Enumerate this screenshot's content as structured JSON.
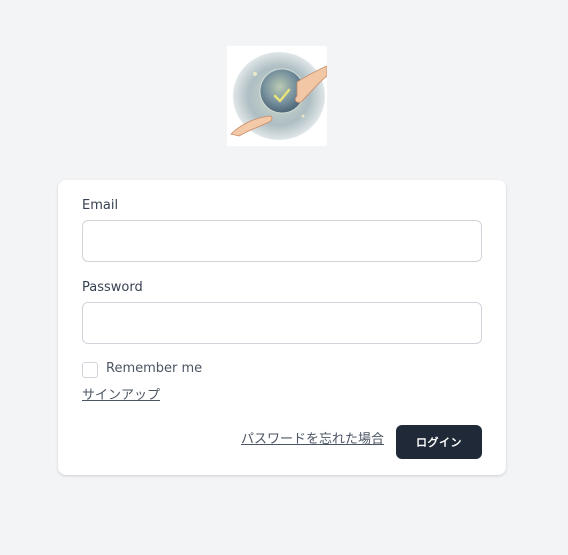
{
  "form": {
    "email_label": "Email",
    "email_value": "",
    "password_label": "Password",
    "password_value": "",
    "remember_label": "Remember me",
    "remember_checked": false,
    "signup_link": "サインアップ",
    "forgot_link": "パスワードを忘れた場合",
    "login_button": "ログイン"
  },
  "colors": {
    "page_background": "#f3f4f6",
    "card_background": "#ffffff",
    "button_background": "#1f2937",
    "input_border": "#d1d5db"
  }
}
